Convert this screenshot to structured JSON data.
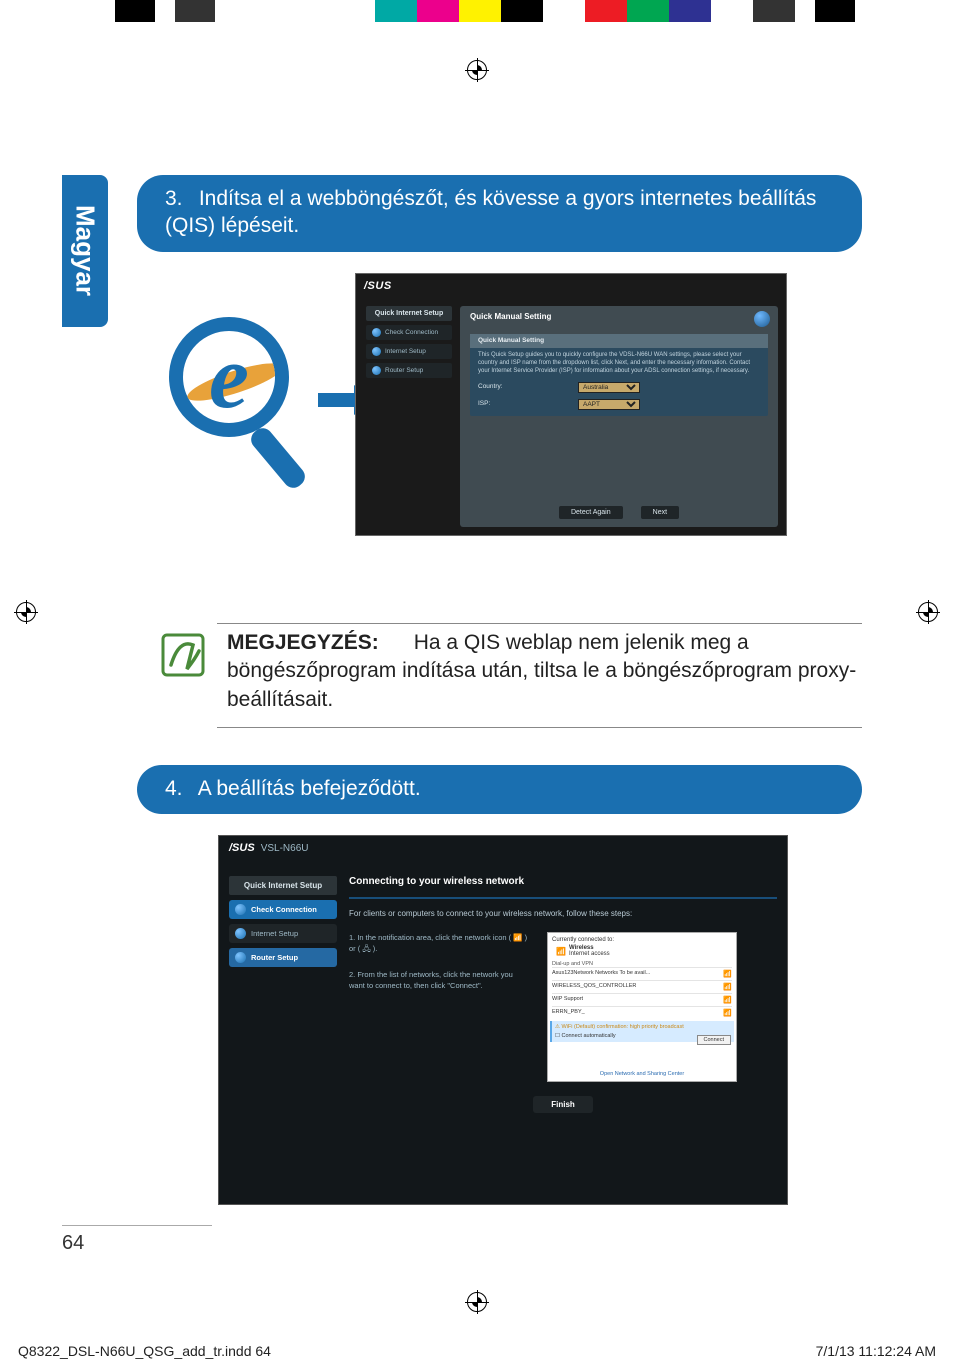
{
  "colorbar": [
    "#ffffff",
    "#000000",
    "#ffffff",
    "#333333",
    "#ffffff",
    "#00a9a5",
    "#ec008c",
    "#fff200",
    "#000000",
    "#ffffff",
    "#ed1c24",
    "#00a651",
    "#2e3192",
    "#ffffff",
    "#333333",
    "#ffffff",
    "#000000",
    "#ffffff"
  ],
  "language_tab": "Magyar",
  "step3": {
    "num": "3.",
    "text": "Indítsa el a webböngészőt, és kövesse a gyors internetes beállítás (QIS) lépéseit."
  },
  "step4": {
    "num": "4.",
    "text": "A beállítás befejeződött."
  },
  "note": {
    "label": "MEGJEGYZÉS:",
    "text": "Ha a QIS weblap nem jelenik meg a böngészőprogram indítása után, tiltsa le a böngészőprogram proxy-beállításait."
  },
  "scr1": {
    "logo": "/SUS",
    "sidebar_header": "Quick Internet Setup",
    "sidebar_items": [
      "Check Connection",
      "Internet Setup",
      "Router Setup"
    ],
    "panel_title": "Quick Manual Setting",
    "inner_header": "Quick Manual Setting",
    "inner_info": "This Quick Setup guides you to quickly configure the VDSL-N66U WAN settings, please select your country and ISP name from the dropdown list, click Next, and enter the necessary information. Contact your Internet Service Provider (ISP) for information about your ADSL connection settings, if necessary.",
    "country_label": "Country:",
    "country_value": "Australia",
    "isp_label": "ISP:",
    "isp_value": "AAPT",
    "btn_detect": "Detect Again",
    "btn_next": "Next"
  },
  "scr2": {
    "logo": "/SUS",
    "model": "VSL-N66U",
    "sidebar_header": "Quick Internet Setup",
    "sidebar_items": [
      {
        "label": "Check Connection",
        "cls": "si-blue"
      },
      {
        "label": "Internet Setup",
        "cls": "si-dark"
      },
      {
        "label": "Router Setup",
        "cls": "si-sel"
      }
    ],
    "main_header": "Connecting to your wireless network",
    "sub": "For clients or computers to connect to your wireless network, follow these steps:",
    "left1": "1. In the notification area, click the network icon ( 📶 ) or ( 🖧 ).",
    "left2": "2. From the list of networks, click the network you want to connect to, then click \"Connect\".",
    "netpanel": {
      "currently": "Currently connected to:",
      "wireless": "Wireless",
      "access": "Internet access",
      "dialup": "Dial-up and VPN",
      "items": [
        {
          "name": "Asus123Network Networks   To be avail...",
          "icon": "📶"
        },
        {
          "name": "WIRELESS_QOS_CONTROLLER",
          "icon": "📶"
        },
        {
          "name": "WIP Support",
          "icon": "📶"
        },
        {
          "name": "ERRN_PBY_",
          "icon": "📶"
        }
      ],
      "selected": "WiFi (Default) confirmation: high priority broadcast",
      "auto": "Connect automatically",
      "connect": "Connect",
      "open": "Open Network and Sharing Center"
    },
    "finish": "Finish"
  },
  "page_number": "64",
  "footer_left": "Q8322_DSL-N66U_QSG_add_tr.indd   64",
  "footer_right": "7/1/13   11:12:24 AM"
}
